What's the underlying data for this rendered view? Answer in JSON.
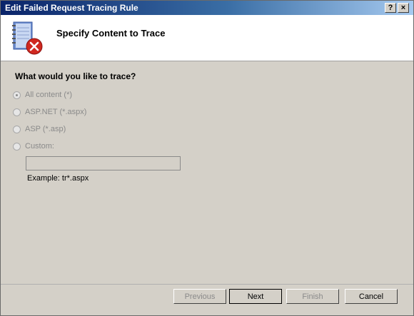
{
  "window": {
    "title": "Edit Failed Request Tracing Rule",
    "help_button": "?",
    "close_button": "×"
  },
  "header": {
    "title": "Specify Content to Trace",
    "icon": "notebook-error-icon"
  },
  "main": {
    "question": "What would you like to trace?",
    "options": [
      {
        "label": "All content (*)",
        "selected": true,
        "enabled": false
      },
      {
        "label": "ASP.NET (*.aspx)",
        "selected": false,
        "enabled": false
      },
      {
        "label": "ASP (*.asp)",
        "selected": false,
        "enabled": false
      },
      {
        "label": "Custom:",
        "selected": false,
        "enabled": false
      }
    ],
    "custom_value": "",
    "example": "Example: tr*.aspx"
  },
  "footer": {
    "previous": "Previous",
    "next": "Next",
    "finish": "Finish",
    "cancel": "Cancel"
  },
  "colors": {
    "titlebar_start": "#0a246a",
    "dialog_bg": "#d4d0c8",
    "error_red": "#d0281f"
  }
}
